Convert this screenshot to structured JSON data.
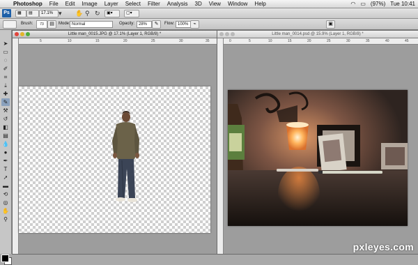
{
  "menubar": {
    "apple": "",
    "items": [
      "Photoshop",
      "File",
      "Edit",
      "Image",
      "Layer",
      "Select",
      "Filter",
      "Analysis",
      "3D",
      "View",
      "Window",
      "Help"
    ],
    "battery": "(97%)",
    "clock": "Tue 10:41"
  },
  "appbar": {
    "logo": "Ps",
    "zoom": "17.1%"
  },
  "options": {
    "brush_label": "Brush:",
    "brush_size": "73",
    "mode_label": "Mode:",
    "mode_value": "Normal",
    "opacity_label": "Opacity:",
    "opacity_value": "28%",
    "flow_label": "Flow:",
    "flow_value": "100%"
  },
  "doc_left": {
    "title": "Little man_0015.JPG @ 17.1% (Layer 1, RGB/8) *",
    "ruler": [
      "5",
      "10",
      "15",
      "20",
      "25",
      "30",
      "35"
    ]
  },
  "doc_right": {
    "title": "Little man_0014.psd @ 15.9% (Layer 1, RGB/8) *",
    "ruler": [
      "0",
      "5",
      "10",
      "15",
      "20",
      "25",
      "30",
      "35",
      "40",
      "45"
    ]
  },
  "watermark": "pxleyes.com",
  "colors": {
    "close": "#e0443b",
    "minimize": "#e3b52a",
    "zoom": "#4fae3b",
    "ps_blue": "#1d5fa8",
    "foreground": "#000000",
    "background": "#ffffff"
  }
}
